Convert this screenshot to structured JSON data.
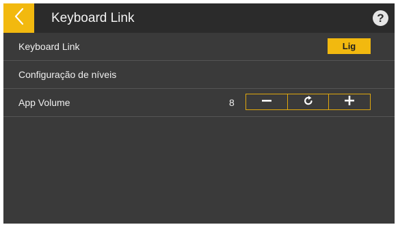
{
  "header": {
    "title": "Keyboard Link",
    "back_icon": "chevron-left-icon",
    "help_icon": "question-mark-icon",
    "help_glyph": "?"
  },
  "rows": [
    {
      "label": "Keyboard Link",
      "control": "toggle",
      "value": "Lig"
    },
    {
      "label": "Configuração de níveis"
    },
    {
      "label": "App Volume",
      "control": "stepper",
      "value": "8",
      "buttons": {
        "decrease_icon": "minus-icon",
        "reset_icon": "refresh-icon",
        "increase_icon": "plus-icon"
      }
    }
  ],
  "colors": {
    "accent": "#f2b90f",
    "background": "#3a3a3a",
    "header_background": "#2b2b2b",
    "text": "#f0f0f0"
  }
}
